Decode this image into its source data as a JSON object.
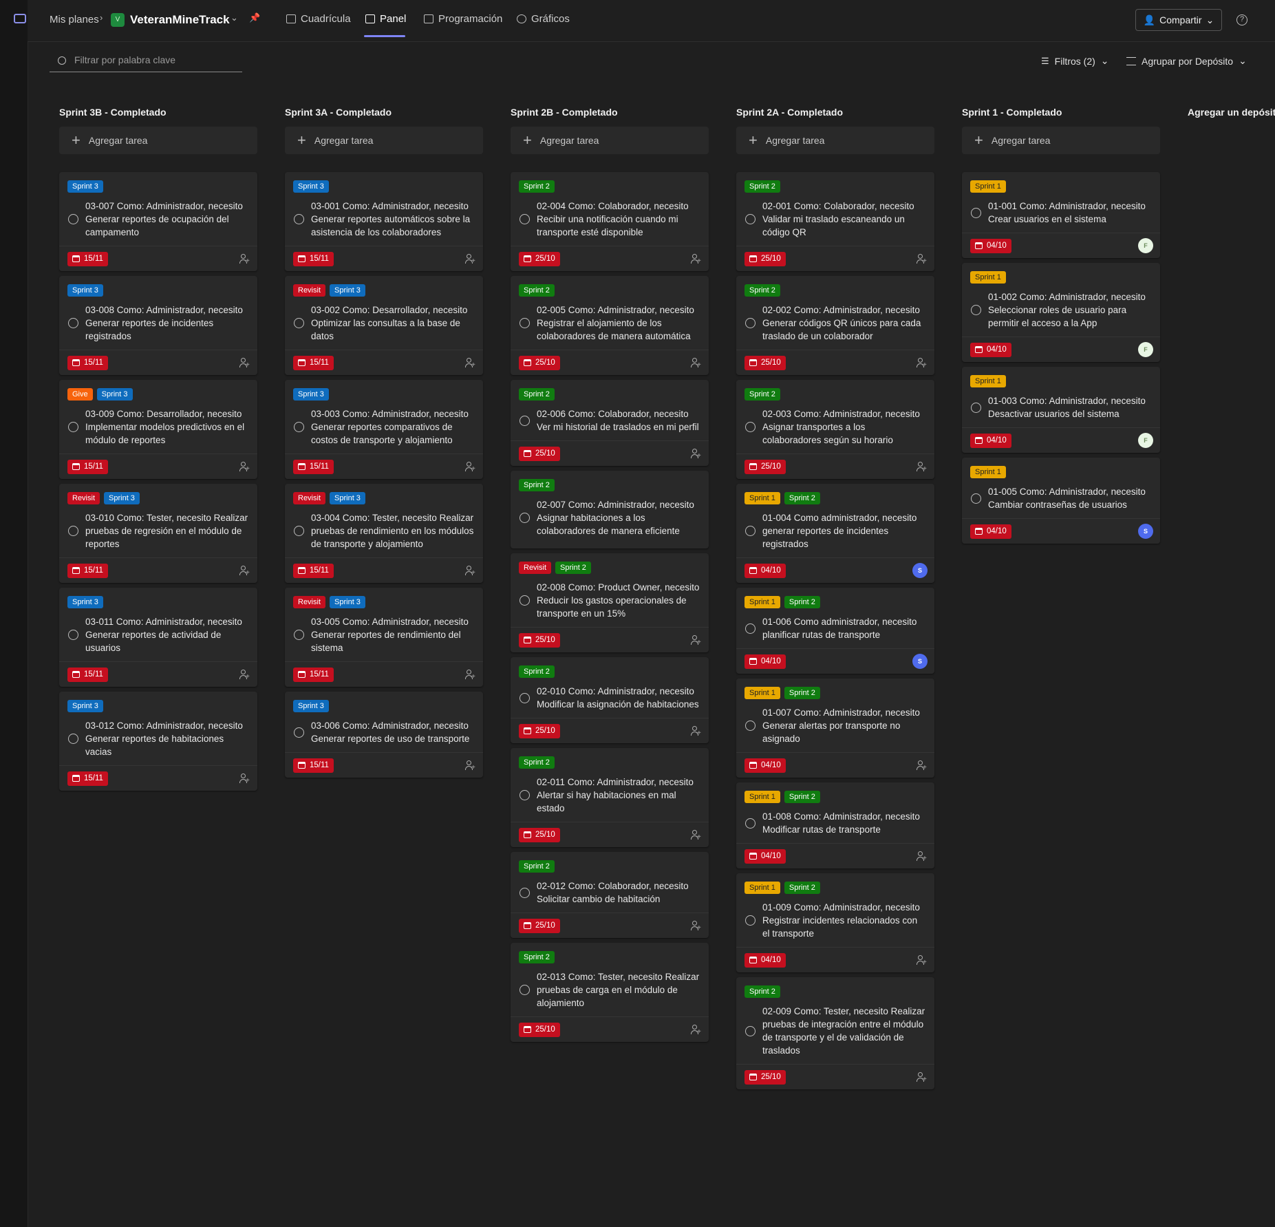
{
  "header": {
    "breadcrumb": "Mis planes",
    "plan_icon": "V",
    "plan_name": "VeteranMineTrack",
    "tabs": [
      {
        "label": "Cuadrícula"
      },
      {
        "label": "Panel"
      },
      {
        "label": "Programación"
      },
      {
        "label": "Gráficos"
      }
    ],
    "share_label": "Compartir",
    "help_label": "?"
  },
  "toolbar": {
    "search_placeholder": "Filtrar por palabra clave",
    "filters_label": "Filtros (2)",
    "group_label": "Agrupar por Depósito"
  },
  "add_task_label": "Agregar tarea",
  "add_bucket_label": "Agregar un depósito",
  "buckets": [
    {
      "title": "Sprint 3B - Completado",
      "cards": [
        {
          "labels": [
            {
              "text": "Sprint 3",
              "kind": "s3"
            }
          ],
          "title": "03-007 Como: Administrador, necesito Generar reportes de ocupación del campamento",
          "date": "15/11",
          "assignee": ""
        },
        {
          "labels": [
            {
              "text": "Sprint 3",
              "kind": "s3"
            }
          ],
          "title": "03-008 Como: Administrador, necesito Generar reportes de incidentes registrados",
          "date": "15/11",
          "assignee": ""
        },
        {
          "labels": [
            {
              "text": "Give",
              "kind": "give"
            },
            {
              "text": "Sprint 3",
              "kind": "s3"
            }
          ],
          "title": "03-009 Como: Desarrollador, necesito Implementar modelos predictivos en el módulo de reportes",
          "date": "15/11",
          "assignee": ""
        },
        {
          "labels": [
            {
              "text": "Revisit",
              "kind": "rev"
            },
            {
              "text": "Sprint 3",
              "kind": "s3"
            }
          ],
          "title": "03-010 Como: Tester, necesito Realizar pruebas de regresión en el módulo de reportes",
          "date": "15/11",
          "assignee": ""
        },
        {
          "labels": [
            {
              "text": "Sprint 3",
              "kind": "s3"
            }
          ],
          "title": "03-011 Como: Administrador, necesito Generar reportes de actividad de usuarios",
          "date": "15/11",
          "assignee": ""
        },
        {
          "labels": [
            {
              "text": "Sprint 3",
              "kind": "s3"
            }
          ],
          "title": "03-012 Como: Administrador, necesito Generar reportes de habitaciones vacias",
          "date": "15/11",
          "assignee": ""
        }
      ]
    },
    {
      "title": "Sprint 3A - Completado",
      "cards": [
        {
          "labels": [
            {
              "text": "Sprint 3",
              "kind": "s3"
            }
          ],
          "title": "03-001 Como: Administrador, necesito Generar reportes automáticos sobre la asistencia de los colaboradores",
          "date": "15/11",
          "assignee": ""
        },
        {
          "labels": [
            {
              "text": "Revisit",
              "kind": "rev"
            },
            {
              "text": "Sprint 3",
              "kind": "s3"
            }
          ],
          "title": "03-002 Como: Desarrollador, necesito Optimizar las consultas a la base de datos",
          "date": "15/11",
          "assignee": ""
        },
        {
          "labels": [
            {
              "text": "Sprint 3",
              "kind": "s3"
            }
          ],
          "title": "03-003 Como: Administrador, necesito Generar reportes comparativos de costos de transporte y alojamiento",
          "date": "15/11",
          "assignee": ""
        },
        {
          "labels": [
            {
              "text": "Revisit",
              "kind": "rev"
            },
            {
              "text": "Sprint 3",
              "kind": "s3"
            }
          ],
          "title": "03-004 Como: Tester, necesito Realizar pruebas de rendimiento en los módulos de transporte y alojamiento",
          "date": "15/11",
          "assignee": ""
        },
        {
          "labels": [
            {
              "text": "Revisit",
              "kind": "rev"
            },
            {
              "text": "Sprint 3",
              "kind": "s3"
            }
          ],
          "title": "03-005 Como: Administrador, necesito Generar reportes de rendimiento del sistema",
          "date": "15/11",
          "assignee": ""
        },
        {
          "labels": [
            {
              "text": "Sprint 3",
              "kind": "s3"
            }
          ],
          "title": "03-006 Como: Administrador, necesito Generar reportes de uso de transporte",
          "date": "15/11",
          "assignee": ""
        }
      ]
    },
    {
      "title": "Sprint 2B - Completado",
      "cards": [
        {
          "labels": [
            {
              "text": "Sprint 2",
              "kind": "s2"
            }
          ],
          "title": "02-004 Como: Colaborador, necesito Recibir una notificación cuando mi transporte esté disponible",
          "date": "25/10",
          "assignee": ""
        },
        {
          "labels": [
            {
              "text": "Sprint 2",
              "kind": "s2"
            }
          ],
          "title": "02-005 Como: Administrador, necesito Registrar el alojamiento de los colaboradores de manera automática",
          "date": "25/10",
          "assignee": ""
        },
        {
          "labels": [
            {
              "text": "Sprint 2",
              "kind": "s2"
            }
          ],
          "title": "02-006 Como: Colaborador, necesito Ver mi historial de traslados en mi perfil",
          "date": "25/10",
          "assignee": ""
        },
        {
          "labels": [
            {
              "text": "Sprint 2",
              "kind": "s2"
            }
          ],
          "title": "02-007 Como: Administrador, necesito Asignar habitaciones a los colaboradores de manera eficiente",
          "date": "",
          "assignee": "",
          "no_footer": true
        },
        {
          "labels": [
            {
              "text": "Revisit",
              "kind": "rev"
            },
            {
              "text": "Sprint 2",
              "kind": "s2"
            }
          ],
          "title": "02-008 Como: Product Owner, necesito Reducir los gastos operacionales de transporte en un 15%",
          "date": "25/10",
          "assignee": ""
        },
        {
          "labels": [
            {
              "text": "Sprint 2",
              "kind": "s2"
            }
          ],
          "title": "02-010 Como: Administrador, necesito Modificar la asignación de habitaciones",
          "date": "25/10",
          "assignee": ""
        },
        {
          "labels": [
            {
              "text": "Sprint 2",
              "kind": "s2"
            }
          ],
          "title": "02-011 Como: Administrador, necesito Alertar si hay habitaciones en mal estado",
          "date": "25/10",
          "assignee": ""
        },
        {
          "labels": [
            {
              "text": "Sprint 2",
              "kind": "s2"
            }
          ],
          "title": "02-012 Como: Colaborador, necesito Solicitar cambio de habitación",
          "date": "25/10",
          "assignee": ""
        },
        {
          "labels": [
            {
              "text": "Sprint 2",
              "kind": "s2"
            }
          ],
          "title": "02-013 Como: Tester, necesito Realizar pruebas de carga en el módulo de alojamiento",
          "date": "25/10",
          "assignee": ""
        }
      ]
    },
    {
      "title": "Sprint 2A - Completado",
      "cards": [
        {
          "labels": [
            {
              "text": "Sprint 2",
              "kind": "s2"
            }
          ],
          "title": "02-001 Como: Colaborador, necesito Validar mi traslado escaneando un código QR",
          "date": "25/10",
          "assignee": ""
        },
        {
          "labels": [
            {
              "text": "Sprint 2",
              "kind": "s2"
            }
          ],
          "title": "02-002 Como: Administrador, necesito Generar códigos QR únicos para cada traslado de un colaborador",
          "date": "25/10",
          "assignee": ""
        },
        {
          "labels": [
            {
              "text": "Sprint 2",
              "kind": "s2"
            }
          ],
          "title": "02-003 Como: Administrador, necesito Asignar transportes a los colaboradores según su horario",
          "date": "25/10",
          "assignee": ""
        },
        {
          "labels": [
            {
              "text": "Sprint 1",
              "kind": "s1"
            },
            {
              "text": "Sprint 2",
              "kind": "s2"
            }
          ],
          "title": "01-004 Como administrador, necesito generar reportes de incidentes registrados",
          "date": "04/10",
          "assignee": "S"
        },
        {
          "labels": [
            {
              "text": "Sprint 1",
              "kind": "s1"
            },
            {
              "text": "Sprint 2",
              "kind": "s2"
            }
          ],
          "title": "01-006 Como administrador, necesito planificar rutas de transporte",
          "date": "04/10",
          "assignee": "S"
        },
        {
          "labels": [
            {
              "text": "Sprint 1",
              "kind": "s1"
            },
            {
              "text": "Sprint 2",
              "kind": "s2"
            }
          ],
          "title": "01-007 Como: Administrador, necesito Generar alertas por transporte no asignado",
          "date": "04/10",
          "assignee": ""
        },
        {
          "labels": [
            {
              "text": "Sprint 1",
              "kind": "s1"
            },
            {
              "text": "Sprint 2",
              "kind": "s2"
            }
          ],
          "title": "01-008 Como: Administrador, necesito Modificar rutas de transporte",
          "date": "04/10",
          "assignee": ""
        },
        {
          "labels": [
            {
              "text": "Sprint 1",
              "kind": "s1"
            },
            {
              "text": "Sprint 2",
              "kind": "s2"
            }
          ],
          "title": "01-009 Como: Administrador, necesito Registrar incidentes relacionados con el transporte",
          "date": "04/10",
          "assignee": ""
        },
        {
          "labels": [
            {
              "text": "Sprint 2",
              "kind": "s2"
            }
          ],
          "title": "02-009 Como: Tester, necesito Realizar pruebas de integración entre el módulo de transporte y el de validación de traslados",
          "date": "25/10",
          "assignee": ""
        }
      ]
    },
    {
      "title": "Sprint 1 - Completado",
      "cards": [
        {
          "labels": [
            {
              "text": "Sprint 1",
              "kind": "s1"
            }
          ],
          "title": "01-001 Como: Administrador, necesito Crear usuarios en el sistema",
          "date": "04/10",
          "assignee": "F"
        },
        {
          "labels": [
            {
              "text": "Sprint 1",
              "kind": "s1"
            }
          ],
          "title": "01-002 Como: Administrador, necesito Seleccionar roles de usuario para permitir el acceso a la App",
          "date": "04/10",
          "assignee": "F"
        },
        {
          "labels": [
            {
              "text": "Sprint 1",
              "kind": "s1"
            }
          ],
          "title": "01-003 Como: Administrador, necesito Desactivar usuarios del sistema",
          "date": "04/10",
          "assignee": "F"
        },
        {
          "labels": [
            {
              "text": "Sprint 1",
              "kind": "s1"
            }
          ],
          "title": "01-005 Como: Administrador, necesito Cambiar contraseñas de usuarios",
          "date": "04/10",
          "assignee": "S"
        }
      ]
    }
  ]
}
